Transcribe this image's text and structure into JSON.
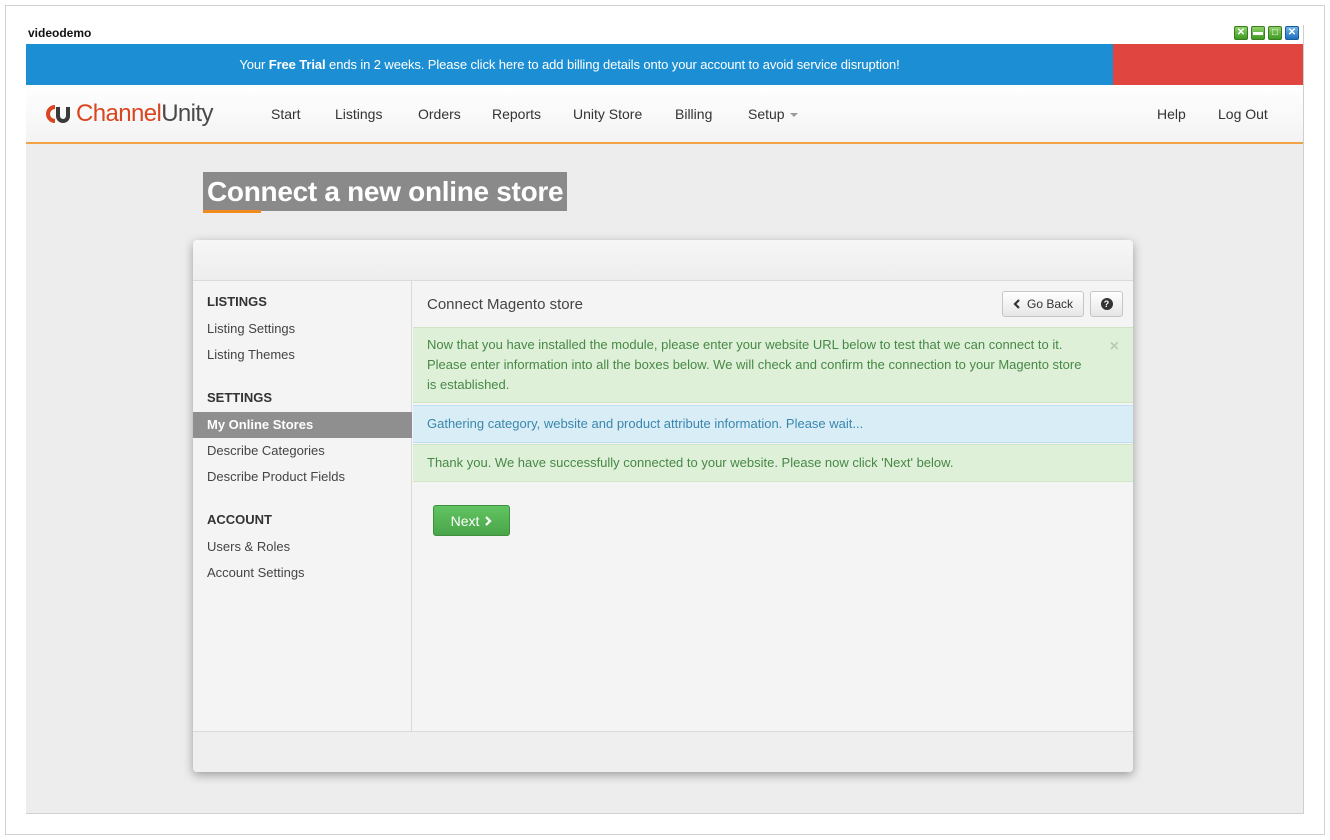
{
  "window": {
    "title": "videodemo",
    "controls": [
      "expand-icon",
      "minimize-icon",
      "maximize-icon",
      "close-icon"
    ]
  },
  "trial_banner": {
    "prefix": "Your ",
    "bold": "Free Trial",
    "suffix": " ends in 2 weeks. Please click here to add billing details onto your account to avoid service disruption!",
    "bg_color": "#1c8fd4",
    "accent_color": "#e0463f"
  },
  "navbar": {
    "logo_part1": "Channel",
    "logo_part2": "Unity",
    "items": [
      "Start",
      "Listings",
      "Orders",
      "Reports",
      "Unity Store",
      "Billing",
      "Setup"
    ],
    "right_items": [
      "Help",
      "Log Out"
    ]
  },
  "page": {
    "title": "Connect a new online store"
  },
  "sidebar": {
    "sections": [
      {
        "heading": "LISTINGS",
        "items": [
          "Listing Settings",
          "Listing Themes"
        ]
      },
      {
        "heading": "SETTINGS",
        "items": [
          "My Online Stores",
          "Describe Categories",
          "Describe Product Fields"
        ]
      },
      {
        "heading": "ACCOUNT",
        "items": [
          "Users & Roles",
          "Account Settings"
        ]
      }
    ],
    "active_item": "My Online Stores"
  },
  "content": {
    "title": "Connect Magento store",
    "go_back_label": "Go Back",
    "alerts": {
      "info_line1": "Now that you have installed the module, please enter your website URL below to test that we can connect to it.",
      "info_line2": "Please enter information into all the boxes below. We will check and confirm the connection to your Magento store",
      "info_line3": "is established.",
      "progress": "Gathering category, website and product attribute information. Please wait...",
      "success": "Thank you. We have successfully connected to your website. Please now click 'Next' below."
    },
    "next_label": "Next"
  }
}
